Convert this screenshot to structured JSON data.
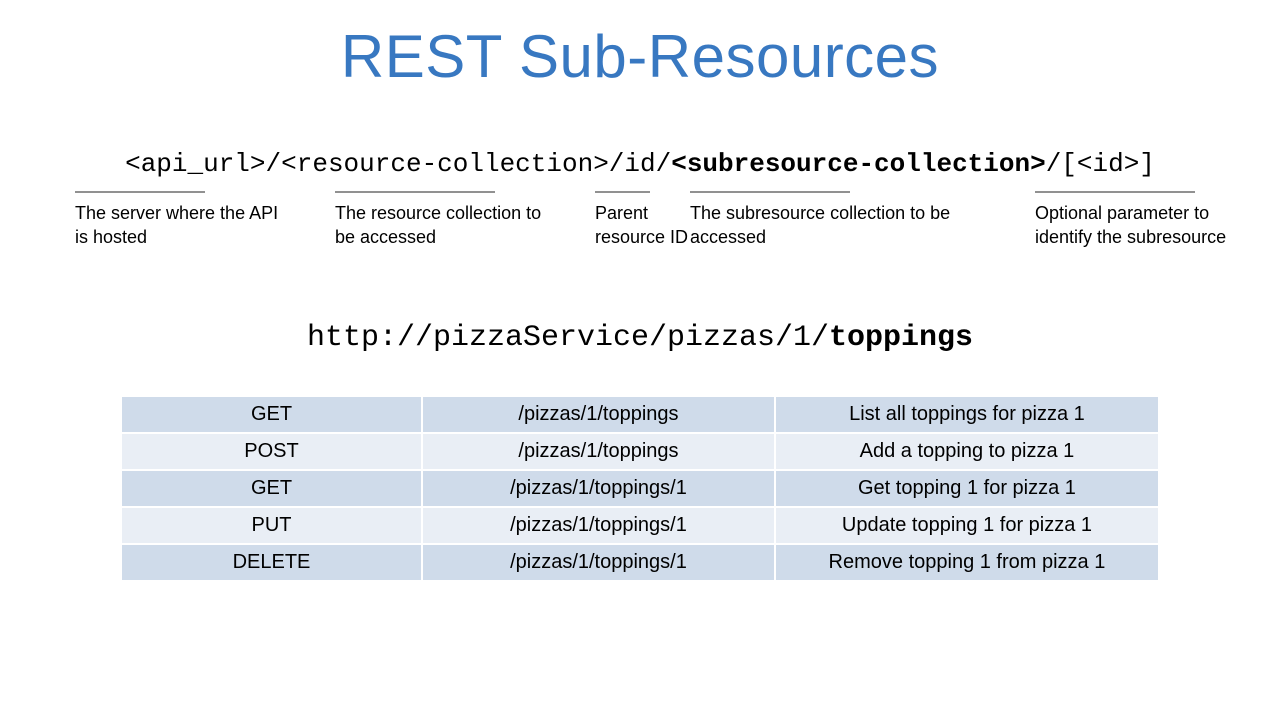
{
  "title": "REST Sub-Resources",
  "pattern": {
    "p1": "<api_url>",
    "s1": "/",
    "p2": "<resource-collection>",
    "s2": "/id/",
    "p3": "<subresource-collection>",
    "s3": "/[<id>]"
  },
  "desc": {
    "d1": "The server where the API is hosted",
    "d2": "The resource collection to be accessed",
    "d3": "Parent resource ID",
    "d4": "The subresource collection to be accessed",
    "d5": "Optional parameter to identify the subresource"
  },
  "example": {
    "prefix": "http://pizzaService/pizzas/1/",
    "bold": "toppings"
  },
  "table": {
    "rows": [
      {
        "method": "GET",
        "path": "/pizzas/1/toppings",
        "desc": "List all toppings for pizza 1"
      },
      {
        "method": "POST",
        "path": "/pizzas/1/toppings",
        "desc": "Add a topping to pizza 1"
      },
      {
        "method": "GET",
        "path": "/pizzas/1/toppings/1",
        "desc": "Get topping 1 for pizza 1"
      },
      {
        "method": "PUT",
        "path": "/pizzas/1/toppings/1",
        "desc": "Update topping 1 for pizza 1"
      },
      {
        "method": "DELETE",
        "path": "/pizzas/1/toppings/1",
        "desc": "Remove topping 1 from pizza 1"
      }
    ]
  }
}
